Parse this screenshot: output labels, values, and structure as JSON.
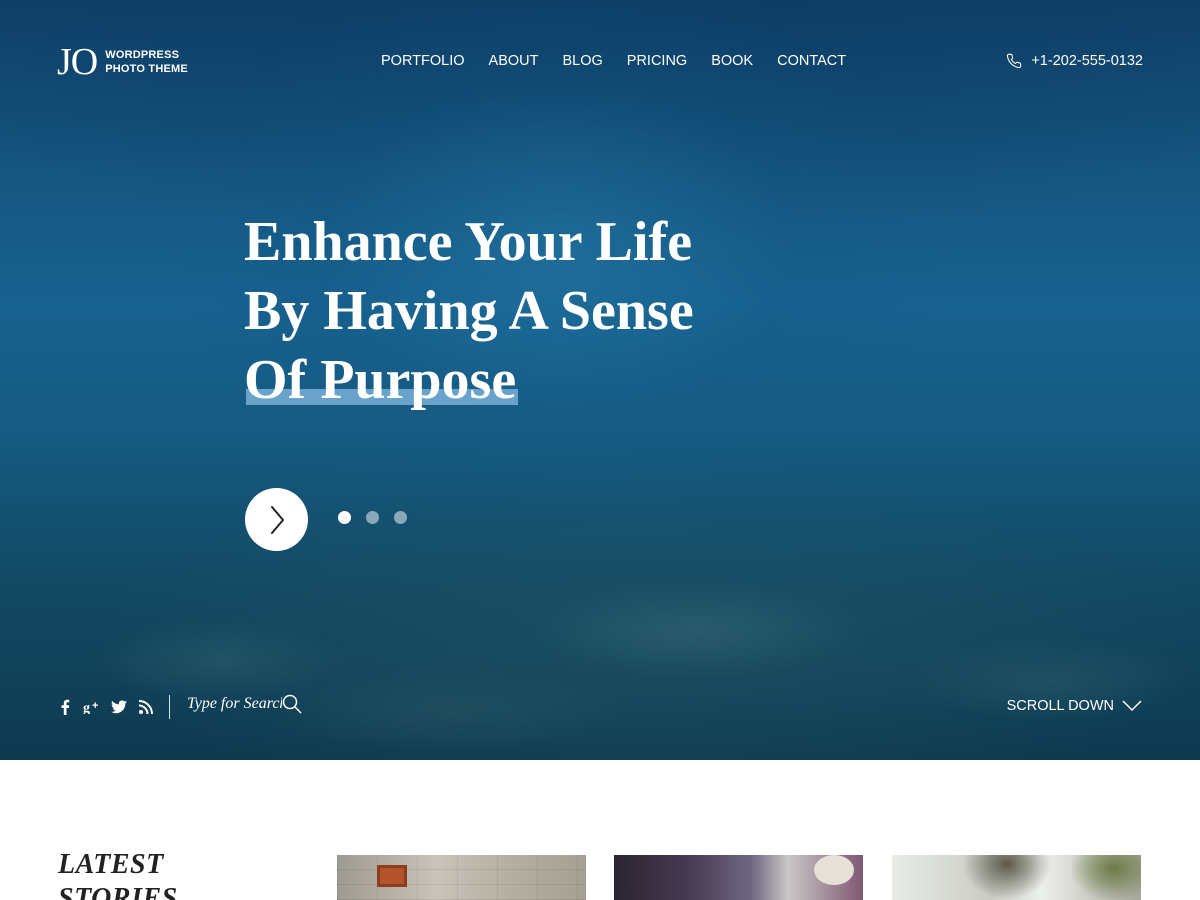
{
  "brand": {
    "mark": "JO",
    "line1": "WORDPRESS",
    "line2": "PHOTO THEME"
  },
  "nav": {
    "items": [
      "PORTFOLIO",
      "ABOUT",
      "BLOG",
      "PRICING",
      "BOOK",
      "CONTACT"
    ]
  },
  "contact": {
    "phone": "+1-202-555-0132",
    "icon": "phone-icon"
  },
  "hero": {
    "headline_line1": "Enhance Your Life",
    "headline_line2": "By Having A Sense",
    "headline_line3": "Of  Purpose",
    "slides_total": 3,
    "active_slide": 1
  },
  "footer_bar": {
    "social": [
      "facebook-icon",
      "google-plus-icon",
      "twitter-icon",
      "rss-icon"
    ],
    "search_placeholder": "Type for Search",
    "scroll_label": "SCROLL DOWN"
  },
  "latest": {
    "title_line1": "LATEST",
    "title_line2": "STORIES"
  },
  "colors": {
    "hero_deep": "#0f3f67",
    "hero_mid": "#186290",
    "highlight": "#78afd7",
    "text_dark": "#222222"
  }
}
